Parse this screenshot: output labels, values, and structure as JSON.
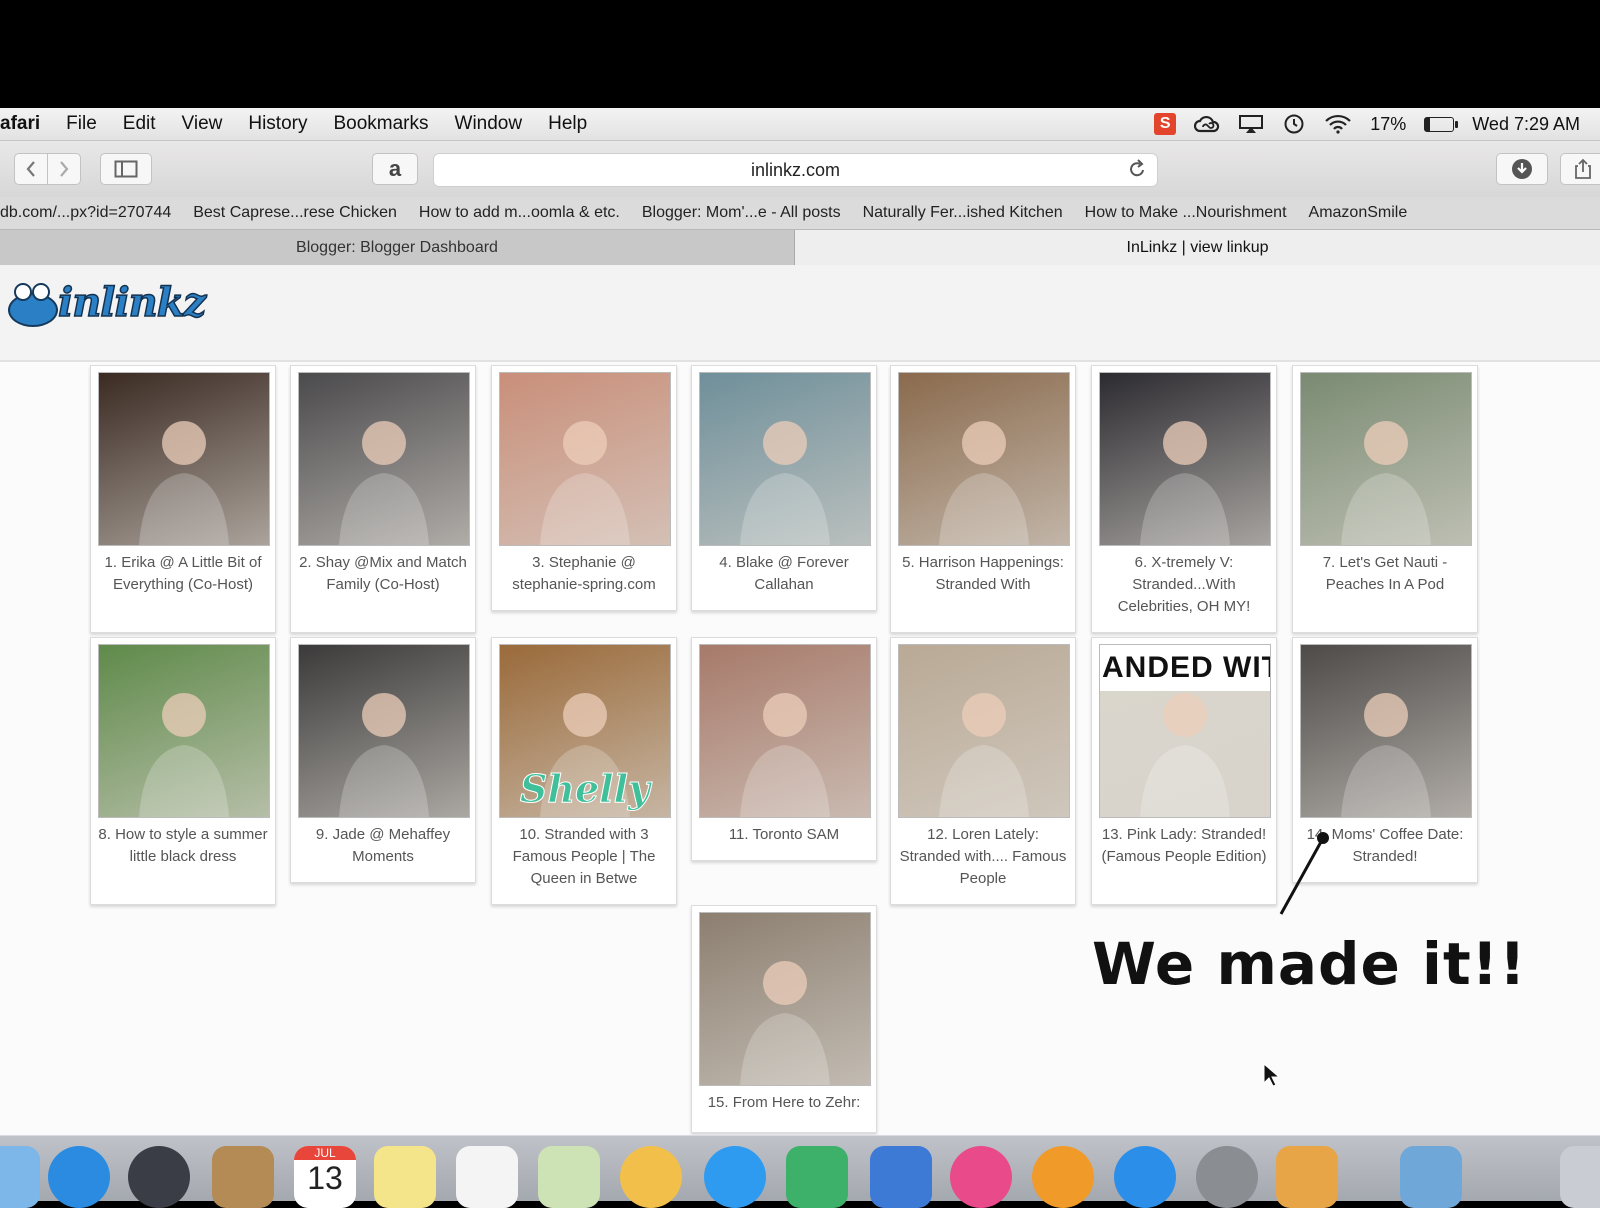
{
  "menubar": {
    "app": "afari",
    "menus": [
      "File",
      "Edit",
      "View",
      "History",
      "Bookmarks",
      "Window",
      "Help"
    ],
    "status": {
      "s_badge": "S",
      "battery": "17%",
      "battery_level": 0.17,
      "clock": "Wed 7:29 AM"
    }
  },
  "toolbar": {
    "url": "inlinkz.com",
    "amazon_glyph": "a"
  },
  "bookmarks": [
    "db.com/...px?id=270744",
    "Best Caprese...rese Chicken",
    "How to add m...oomla & etc.",
    "Blogger: Mom'...e - All posts",
    "Naturally Fer...ished Kitchen",
    "How to Make ...Nourishment",
    "AmazonSmile"
  ],
  "tabs": [
    {
      "label": "Blogger: Blogger Dashboard",
      "active": false
    },
    {
      "label": "InLinkz | view linkup",
      "active": true
    }
  ],
  "site": {
    "logo": "inlinkz"
  },
  "entries": [
    {
      "caption": "1. Erika @ A Little Bit of Everything (Co-Host)",
      "photo": "family-at-night-photo",
      "tone": "#3a2a22"
    },
    {
      "caption": "2. Shay @Mix and Match Family (Co-Host)",
      "photo": "family-with-kids-photo",
      "tone": "#4b4a4c"
    },
    {
      "caption": "3. Stephanie @ stephanie-spring.com",
      "photo": "woman-drinking-juice-photo",
      "tone": "#c98f7a"
    },
    {
      "caption": "4. Blake @ Forever Callahan",
      "photo": "woman-smiling-photo",
      "tone": "#6f8f9a"
    },
    {
      "caption": "5. Harrison Happenings: Stranded With",
      "photo": "woman-on-porch-steps-photo",
      "tone": "#8a6a4d"
    },
    {
      "caption": "6. X-tremely V: Stranded...With Celebrities, OH MY!",
      "photo": "family-in-winter-hats-photo",
      "tone": "#2c2b30"
    },
    {
      "caption": "7. Let's Get Nauti - Peaches In A Pod",
      "photo": "woman-walking-outdoors-photo",
      "tone": "#7a8b72"
    },
    {
      "caption": "8. How to style a summer little black dress",
      "photo": "woman-in-black-dress-photo",
      "tone": "#5f8a4a"
    },
    {
      "caption": "9. Jade @ Mehaffey Moments",
      "photo": "car-selfie-photo",
      "tone": "#3b3a3a"
    },
    {
      "caption": "10. Stranded with 3 Famous People | The Queen in Betwe",
      "photo": "shelly-portrait-photo",
      "tone": "#9a6a3a",
      "overlay_text": "Shelly"
    },
    {
      "caption": "11. Toronto SAM",
      "photo": "woman-in-denim-photo",
      "tone": "#a77a6a"
    },
    {
      "caption": "12. Loren Lately: Stranded with.... Famous People",
      "photo": "woman-in-fedora-photo",
      "tone": "#b9a995"
    },
    {
      "caption": "13. Pink Lady: Stranded! (Famous People Edition)",
      "photo": "stranded-with-collage-photo",
      "tone": "#d9d6cc",
      "overlay_text": "ANDED WIT"
    },
    {
      "caption": "14. Moms' Coffee Date: Stranded!",
      "photo": "two-women-sunglasses-photo",
      "tone": "#4d4a48"
    },
    {
      "caption": "15. From Here to Zehr:",
      "photo": "sepia-woman-portrait-photo",
      "tone": "#8c7f70"
    }
  ],
  "annotation": {
    "text": "We made it!!"
  },
  "dock": {
    "icons": [
      {
        "name": "finder-icon",
        "color": "#7db6e8"
      },
      {
        "name": "safari-icon",
        "color": "#2a8be0"
      },
      {
        "name": "launchpad-icon",
        "color": "#3a3d45"
      },
      {
        "name": "contacts-icon",
        "color": "#b48a55"
      },
      {
        "name": "calendar-icon",
        "color": "#ffffff",
        "month": "JUL",
        "day": "13"
      },
      {
        "name": "notes-icon",
        "color": "#f5e58a"
      },
      {
        "name": "reminders-icon",
        "color": "#f4f4f4"
      },
      {
        "name": "maps-icon",
        "color": "#cde2b5"
      },
      {
        "name": "photos-icon",
        "color": "#f2c04a"
      },
      {
        "name": "messages-icon",
        "color": "#2f9bf0"
      },
      {
        "name": "numbers-icon",
        "color": "#3db16a"
      },
      {
        "name": "keynote-icon",
        "color": "#3c7ad6"
      },
      {
        "name": "itunes-icon",
        "color": "#e84a8a"
      },
      {
        "name": "ibooks-icon",
        "color": "#f09a2a"
      },
      {
        "name": "app-store-icon",
        "color": "#2b8ee8"
      },
      {
        "name": "system-preferences-icon",
        "color": "#8a8d92"
      },
      {
        "name": "preview-icon",
        "color": "#e8a548"
      },
      {
        "name": "downloads-folder-icon",
        "color": "#6fa7d8"
      },
      {
        "name": "trash-icon",
        "color": "#c9ccd2"
      }
    ]
  }
}
